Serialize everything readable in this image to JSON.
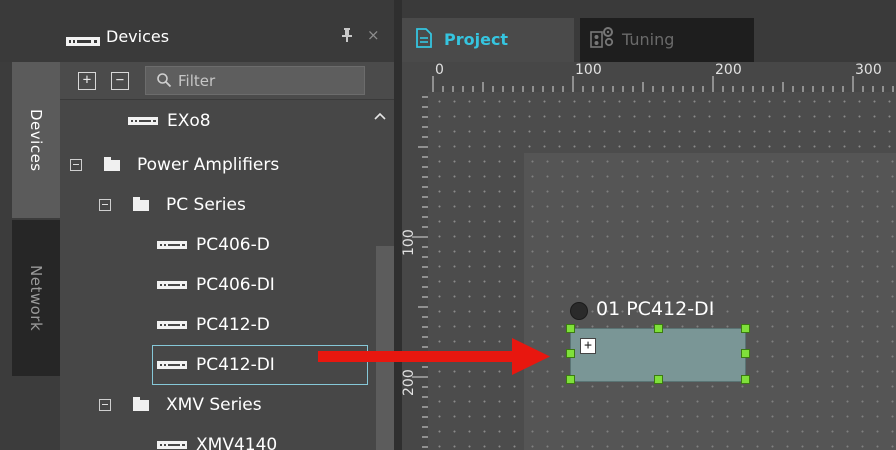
{
  "sidebar_tabs": [
    {
      "label": "Devices",
      "active": true
    },
    {
      "label": "Network",
      "active": false
    }
  ],
  "devices_panel": {
    "title": "Devices",
    "pin_icon": "pin-icon",
    "close_icon": "×",
    "toolbar": {
      "expand_all": "+",
      "collapse_all": "−",
      "filter_placeholder": "Filter"
    },
    "tree": [
      {
        "label": "EXo8",
        "kind": "device",
        "level": 2
      },
      {
        "label": "Power Amplifiers",
        "kind": "folder",
        "level": 0
      },
      {
        "label": "PC Series",
        "kind": "folder",
        "level": 1
      },
      {
        "label": "PC406-D",
        "kind": "device",
        "level": 2
      },
      {
        "label": "PC406-DI",
        "kind": "device",
        "level": 2
      },
      {
        "label": "PC412-D",
        "kind": "device",
        "level": 2
      },
      {
        "label": "PC412-DI",
        "kind": "device",
        "level": 2,
        "selected": true
      },
      {
        "label": "XMV Series",
        "kind": "folder",
        "level": 1
      },
      {
        "label": "XMV4140",
        "kind": "device",
        "level": 2
      }
    ]
  },
  "tabs": [
    {
      "label": "Project",
      "active": true
    },
    {
      "label": "Tuning",
      "active": false
    }
  ],
  "canvas": {
    "ruler_top": [
      "0",
      "100",
      "200",
      "300"
    ],
    "ruler_left": [
      "100",
      "200"
    ],
    "device": {
      "title": "01 PC412-DI",
      "expand": "+"
    }
  },
  "colors": {
    "accent": "#35c5e0",
    "selection_border": "#86c8d8",
    "handle": "#7fe03a",
    "arrow": "#e8170f",
    "device_body": "#7a9696"
  }
}
